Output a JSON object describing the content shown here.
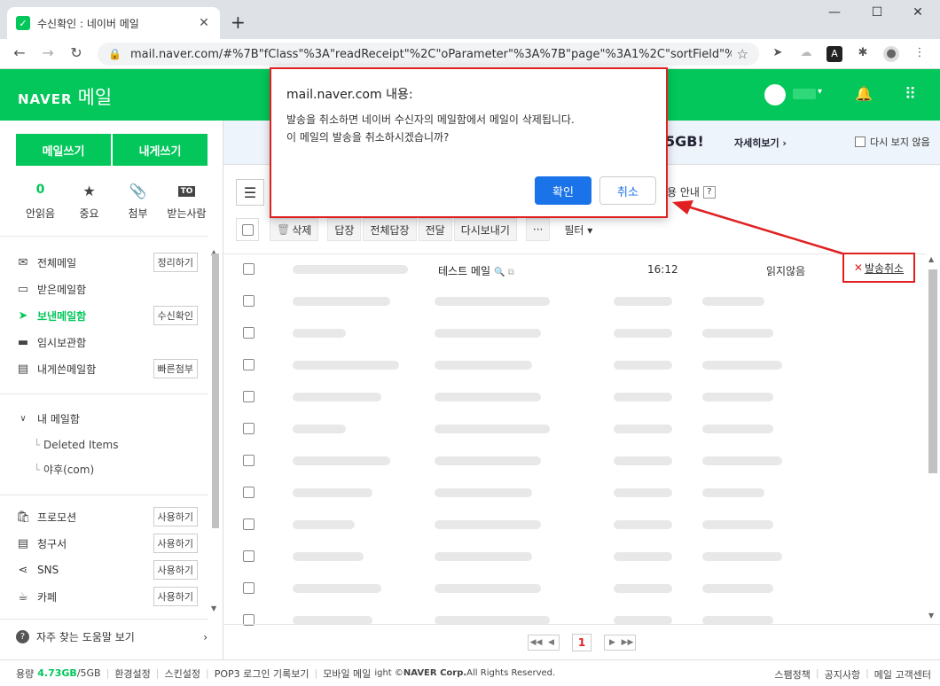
{
  "browser": {
    "tab_title": "수신확인 : 네이버 메일",
    "url": "mail.naver.com/#%7B\"fClass\"%3A\"readReceipt\"%2C\"oParameter\"%3A%7B\"page\"%3A1%2C\"sortField\"%3..."
  },
  "header": {
    "logo_text": "NAVER",
    "logo_service": "메일"
  },
  "sidebar": {
    "write_mail": "메일쓰기",
    "write_self": "내게쓰기",
    "stats": [
      {
        "value": "0",
        "label": "안읽음"
      },
      {
        "value": "★",
        "label": "중요"
      },
      {
        "value": "📎",
        "label": "첨부"
      },
      {
        "value": "TO",
        "label": "받는사람"
      }
    ],
    "mailboxes": [
      {
        "label": "전체메일",
        "tag": "정리하기"
      },
      {
        "label": "받은메일함",
        "tag": ""
      },
      {
        "label": "보낸메일함",
        "tag": "수신확인"
      },
      {
        "label": "임시보관함",
        "tag": ""
      },
      {
        "label": "내게쓴메일함",
        "tag": "빠른첨부"
      }
    ],
    "my_mailbox": "내 메일함",
    "subfolders": [
      "Deleted Items",
      "야후(com)"
    ],
    "apps": [
      {
        "label": "프로모션",
        "tag": "사용하기"
      },
      {
        "label": "청구서",
        "tag": "사용하기"
      },
      {
        "label": "SNS",
        "tag": "사용하기"
      },
      {
        "label": "카페",
        "tag": "사용하기"
      }
    ],
    "help": "자주 찾는 도움말 보기"
  },
  "banner": {
    "headline": "5GB!",
    "detail_link": "자세히보기 ›",
    "hide_check": "다시 보지 않음"
  },
  "toolbar": {
    "guide_text": "용 안내",
    "buttons": [
      "삭제",
      "답장",
      "전체답장",
      "전달",
      "다시보내기",
      "···"
    ],
    "filter": "필터 ▾"
  },
  "mail_list": {
    "first_row": {
      "subject": "테스트 메일",
      "time": "16:12",
      "status": "읽지않음",
      "action": "발송취소"
    },
    "blurred_rows": 11
  },
  "pager": {
    "current_page": "1"
  },
  "footer": {
    "items": [
      "용량",
      "4.73GB",
      "/5GB",
      "환경설정",
      "스킨설정",
      "POP3 로그인 기록보기",
      "모바일 메일",
      "ight © ",
      "NAVER Corp.",
      " All Rights Reserved."
    ],
    "right_links": [
      "스팸정책",
      "공지사항",
      "메일 고객센터"
    ]
  },
  "dialog": {
    "title": "mail.naver.com 내용:",
    "message_line1": "발송을 취소하면 네이버 수신자의 메일함에서 메일이 삭제됩니다.",
    "message_line2": "이 메일의 발송을 취소하시겠습니까?",
    "ok": "확인",
    "cancel": "취소"
  },
  "colors": {
    "naver_green": "#03c75a",
    "annotation_red": "#e02020",
    "dialog_blue": "#1a73e8"
  }
}
